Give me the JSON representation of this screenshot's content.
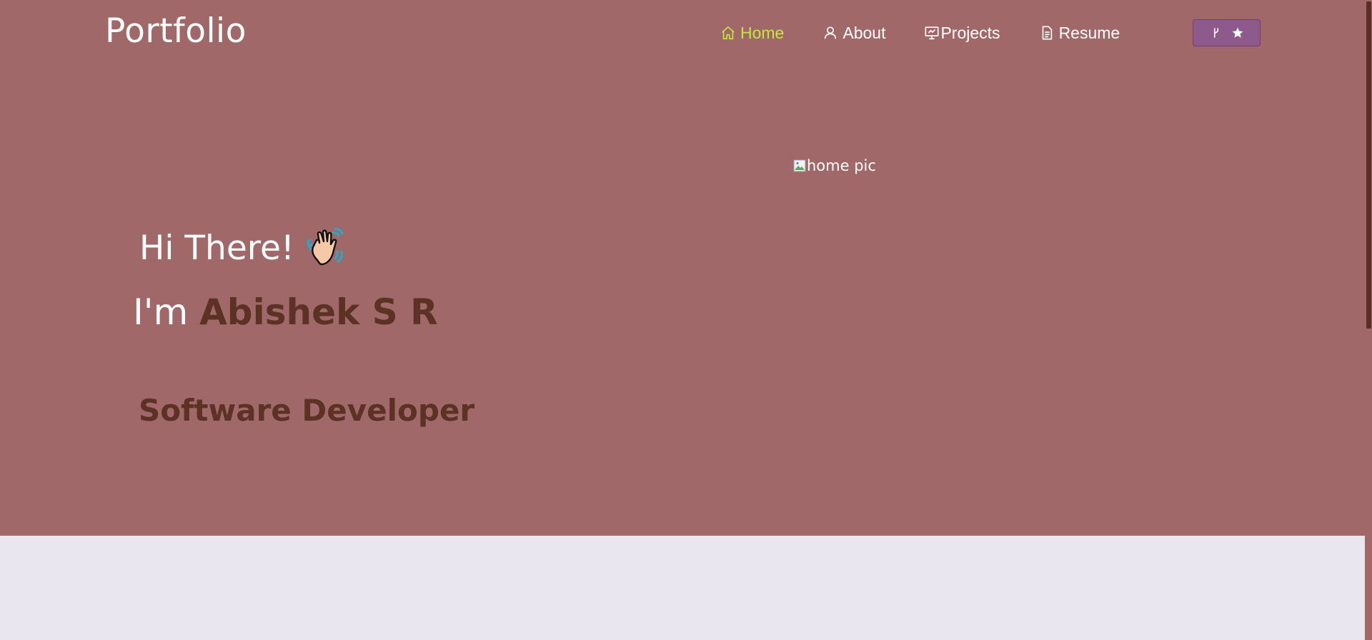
{
  "brand": {
    "title": "Portfolio"
  },
  "nav": {
    "items": [
      {
        "label": "Home",
        "icon": "home-icon",
        "active": true
      },
      {
        "label": "About",
        "icon": "user-icon"
      },
      {
        "label": "Projects",
        "icon": "presentation-icon"
      },
      {
        "label": "Resume",
        "icon": "document-icon"
      }
    ],
    "fork_button": {
      "icons": [
        "git-fork-icon",
        "star-icon"
      ]
    }
  },
  "hero": {
    "greeting": "Hi There!",
    "intro_prefix": "I'm ",
    "name": "Abishek S R",
    "role": "Software Developer",
    "image_alt": "home pic"
  },
  "colors": {
    "hero_bg": "#a06868",
    "accent_active": "#c3e63c",
    "name_color": "#5c3225",
    "button_bg": "#8e5a8c",
    "page_bg": "#e9e6ef"
  }
}
